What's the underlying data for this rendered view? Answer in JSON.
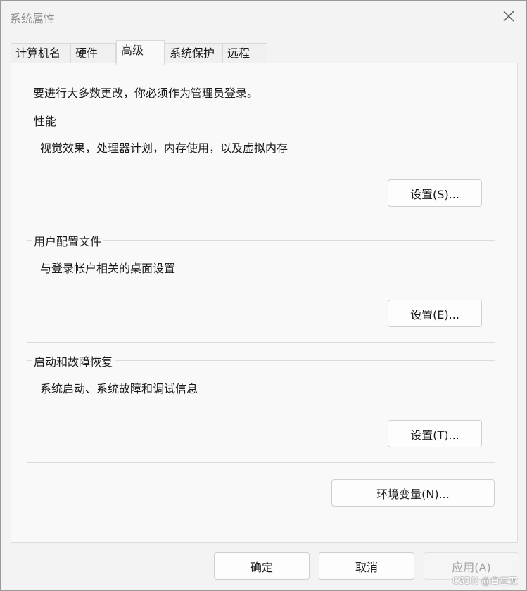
{
  "window": {
    "title": "系统属性"
  },
  "tabs": [
    {
      "label": "计算机名"
    },
    {
      "label": "硬件"
    },
    {
      "label": "高级"
    },
    {
      "label": "系统保护"
    },
    {
      "label": "远程"
    }
  ],
  "panel": {
    "admin_note": "要进行大多数更改，你必须作为管理员登录。",
    "groups": [
      {
        "label": "性能",
        "description": "视觉效果，处理器计划，内存使用，以及虚拟内存",
        "button": "设置(S)..."
      },
      {
        "label": "用户配置文件",
        "description": "与登录帐户相关的桌面设置",
        "button": "设置(E)..."
      },
      {
        "label": "启动和故障恢复",
        "description": "系统启动、系统故障和调试信息",
        "button": "设置(T)..."
      }
    ],
    "env_button": "环境变量(N)..."
  },
  "footer": {
    "ok": "确定",
    "cancel": "取消",
    "apply": "应用(A)"
  },
  "watermark": "CSDN @白豆五"
}
